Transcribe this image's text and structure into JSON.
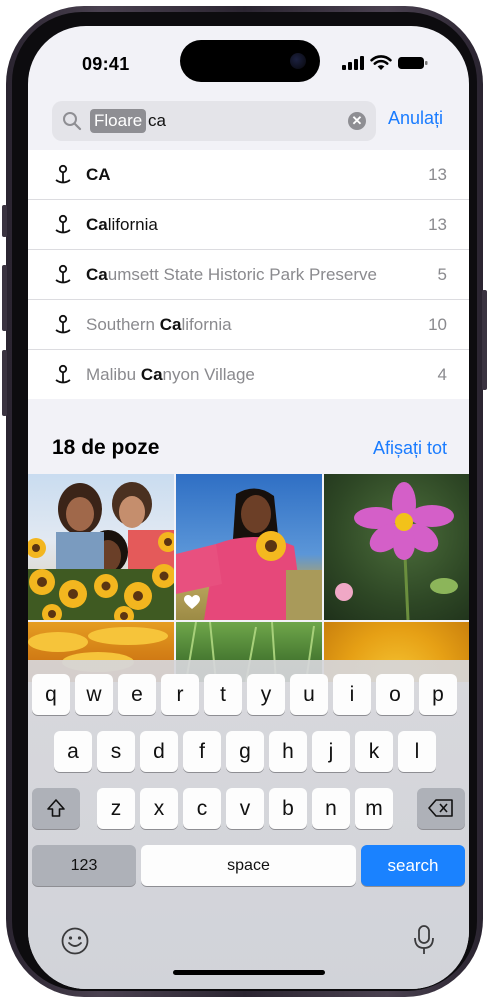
{
  "status": {
    "time": "09:41"
  },
  "search": {
    "token": "Floare",
    "query": "ca",
    "cancel_label": "Anulați"
  },
  "results": [
    {
      "bold": "CA",
      "rest": "",
      "count": "13",
      "dark": true
    },
    {
      "bold": "Ca",
      "rest": "lifornia",
      "count": "13",
      "dark": true
    },
    {
      "bold": "Ca",
      "rest": "umsett State Historic Park Preserve",
      "count": "5",
      "dark": false
    },
    {
      "prefix": "Southern ",
      "bold": "Ca",
      "rest": "lifornia",
      "count": "10",
      "dark": false
    },
    {
      "prefix": "Malibu ",
      "bold": "Ca",
      "rest": "nyon Village",
      "count": "4",
      "dark": false
    }
  ],
  "photos_section": {
    "title": "18 de poze",
    "show_all_label": "Afișați tot"
  },
  "keyboard": {
    "row1": [
      "q",
      "w",
      "e",
      "r",
      "t",
      "y",
      "u",
      "i",
      "o",
      "p"
    ],
    "row2": [
      "a",
      "s",
      "d",
      "f",
      "g",
      "h",
      "j",
      "k",
      "l"
    ],
    "row3": [
      "z",
      "x",
      "c",
      "v",
      "b",
      "n",
      "m"
    ],
    "numbers_label": "123",
    "space_label": "space",
    "search_label": "search"
  },
  "icons": {
    "search": "search-icon",
    "clear": "clear-icon",
    "pin": "map-pin-icon",
    "shift": "shift-icon",
    "delete": "delete-icon",
    "emoji": "emoji-icon",
    "mic": "microphone-icon",
    "favorite": "heart-icon"
  },
  "colors": {
    "accent": "#1a7cff",
    "search_key": "#1a82ff"
  }
}
